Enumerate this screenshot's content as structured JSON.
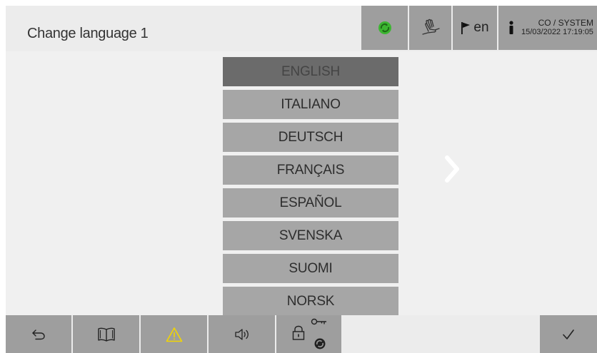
{
  "header": {
    "title": "Change language 1",
    "language_code": "en",
    "user_line1": "CO / SYSTEM",
    "user_line2": "15/03/2022 17:19:05"
  },
  "icons": {
    "sync": "sync-status-icon",
    "hand": "manual-hand-icon",
    "flag": "flag-icon",
    "user": "user-info-icon",
    "back": "back-arrow-icon",
    "book": "manual-book-icon",
    "warning": "warning-icon",
    "sound": "speaker-icon",
    "lock": "lock-icon",
    "key": "key-icon",
    "confirm": "checkmark-icon",
    "next": "chevron-right-icon"
  },
  "colors": {
    "accent_green": "#3cb531",
    "warning_yellow": "#f2d500",
    "button_gray": "#9e9e9e",
    "selected_gray": "#6b6b6b"
  },
  "languages": [
    {
      "label": "ENGLISH",
      "selected": true
    },
    {
      "label": "ITALIANO",
      "selected": false
    },
    {
      "label": "DEUTSCH",
      "selected": false
    },
    {
      "label": "FRANÇAIS",
      "selected": false
    },
    {
      "label": "ESPAÑOL",
      "selected": false
    },
    {
      "label": "SVENSKA",
      "selected": false
    },
    {
      "label": "SUOMI",
      "selected": false
    },
    {
      "label": "NORSK",
      "selected": false
    }
  ]
}
